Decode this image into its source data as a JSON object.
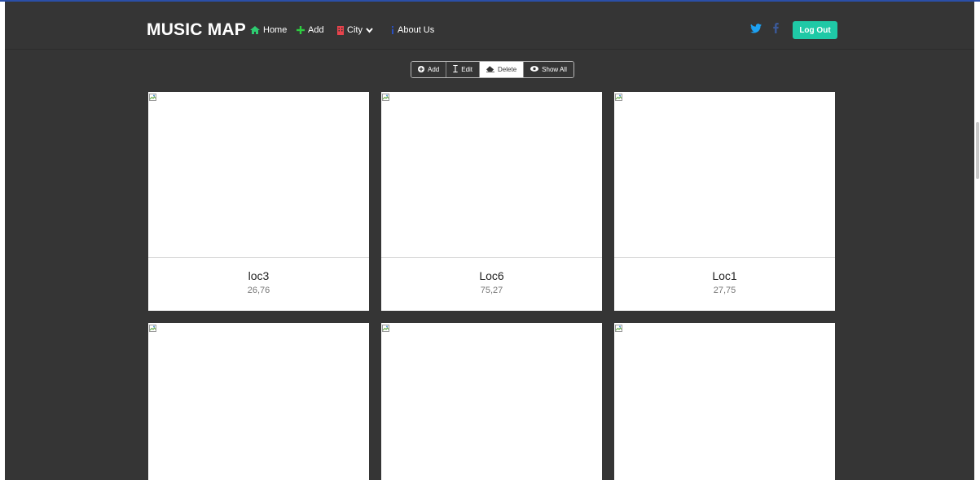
{
  "brand": "MUSIC MAP",
  "nav": {
    "home": "Home",
    "add": "Add",
    "city": "City",
    "about": "About Us",
    "logout": "Log Out"
  },
  "social": [
    "twitter-icon",
    "facebook-icon"
  ],
  "toolbar": {
    "add": "Add",
    "edit": "Edit",
    "delete": "Delete",
    "show_all": "Show All",
    "active": "Delete"
  },
  "locations": [
    {
      "name": "loc3",
      "coords": "26,76"
    },
    {
      "name": "Loc6",
      "coords": "75,27"
    },
    {
      "name": "Loc1",
      "coords": "27,75"
    },
    {
      "name": "",
      "coords": ""
    },
    {
      "name": "",
      "coords": ""
    },
    {
      "name": "",
      "coords": ""
    }
  ],
  "colors": {
    "background": "#353535",
    "accent": "#1fc9a6",
    "home_icon": "#2ecc71",
    "add_icon": "#2ecc40",
    "city_icon": "#e8434c",
    "twitter": "#1da1f2",
    "facebook": "#3b5998"
  }
}
